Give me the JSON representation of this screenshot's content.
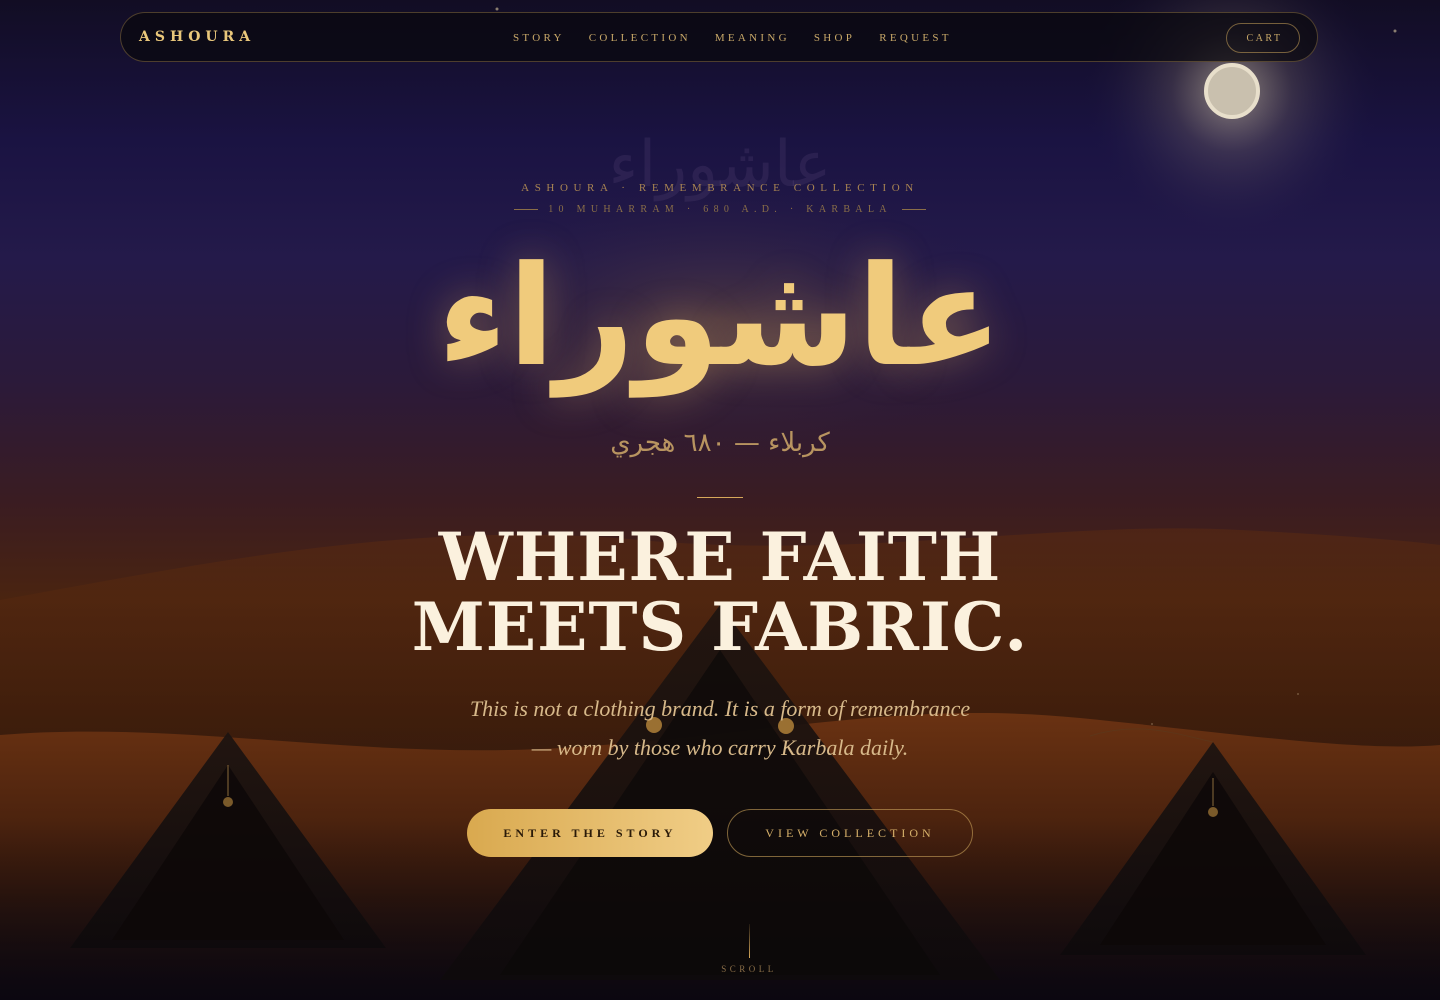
{
  "nav": {
    "brand": "ASHOURA",
    "links": [
      "STORY",
      "COLLECTION",
      "MEANING",
      "SHOP",
      "REQUEST"
    ],
    "cart": "CART"
  },
  "hero": {
    "eyebrow": "ASHOURA · REMEMBRANCE COLLECTION",
    "eyebrow_sub": "10 MUHARRAM · 680 A.D. · KARBALA",
    "arabic_ghost": "عاشوراء",
    "arabic_title": "عاشوراء",
    "arabic_sub": "كربلاء — ٦٨٠ هجري",
    "headline_line1": "WHERE FAITH",
    "headline_line2": "MEETS FABRIC.",
    "tagline_line1": "This is not a clothing brand. It is a form of remembrance",
    "tagline_line2": "— worn by those who carry Karbala daily.",
    "primary_cta": "ENTER THE STORY",
    "secondary_cta": "VIEW COLLECTION",
    "scroll_label": "SCROLL"
  },
  "colors": {
    "gold": "#e9c77b",
    "headline": "#fbf1de",
    "night": "#1a1342",
    "desert": "#4a2410"
  },
  "icons": {
    "moon": "moon-icon",
    "tents": "tent-icon"
  }
}
